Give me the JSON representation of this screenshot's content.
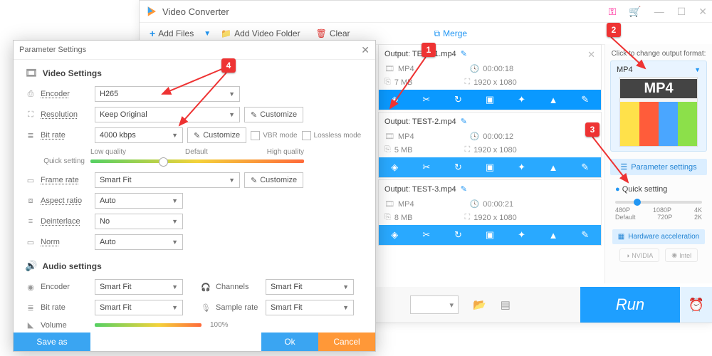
{
  "app": {
    "title": "Video Converter"
  },
  "toolbar": {
    "add_files": "Add Files",
    "add_folder": "Add Video Folder",
    "clear": "Clear",
    "merge": "Merge"
  },
  "files": [
    {
      "name": "Output: TEST-1.mp4",
      "format": "MP4",
      "duration": "00:00:18",
      "size": "7 MB",
      "dims": "1920 x 1080"
    },
    {
      "name": "Output: TEST-2.mp4",
      "format": "MP4",
      "duration": "00:00:12",
      "size": "5 MB",
      "dims": "1920 x 1080"
    },
    {
      "name": "Output: TEST-3.mp4",
      "format": "MP4",
      "duration": "00:00:21",
      "size": "8 MB",
      "dims": "1920 x 1080"
    }
  ],
  "right": {
    "hint": "Click to change output format:",
    "format": "MP4",
    "param_btn": "Parameter settings",
    "quick": "Quick setting",
    "res_labels": [
      "480P",
      "1080P",
      "4K",
      "Default",
      "720P",
      "2K"
    ],
    "hw": "Hardware acceleration",
    "gpu1": "NVIDIA",
    "gpu2": "Intel"
  },
  "run": "Run",
  "dialog": {
    "title": "Parameter Settings",
    "video_section": "Video Settings",
    "audio_section": "Audio settings",
    "labels": {
      "encoder": "Encoder",
      "resolution": "Resolution",
      "bitrate": "Bit rate",
      "framerate": "Frame rate",
      "aspect": "Aspect ratio",
      "deinterlace": "Deinterlace",
      "norm": "Norm",
      "channels": "Channels",
      "samplerate": "Sample rate",
      "volume": "Volume"
    },
    "values": {
      "v_encoder": "H265",
      "resolution": "Keep Original",
      "bitrate": "4000 kbps",
      "framerate": "Smart Fit",
      "aspect": "Auto",
      "deinterlace": "No",
      "norm": "Auto",
      "a_encoder": "Smart Fit",
      "a_bitrate": "Smart Fit",
      "channels": "Smart Fit",
      "samplerate": "Smart Fit",
      "volume": "100%"
    },
    "customize": "Customize",
    "vbrmode": "VBR mode",
    "lossless": "Lossless mode",
    "quick_setting": "Quick setting",
    "slider_labels": [
      "Low quality",
      "Default",
      "High quality"
    ],
    "buttons": {
      "save": "Save as",
      "ok": "Ok",
      "cancel": "Cancel"
    }
  },
  "callouts": {
    "c1": "1",
    "c2": "2",
    "c3": "3",
    "c4": "4"
  }
}
